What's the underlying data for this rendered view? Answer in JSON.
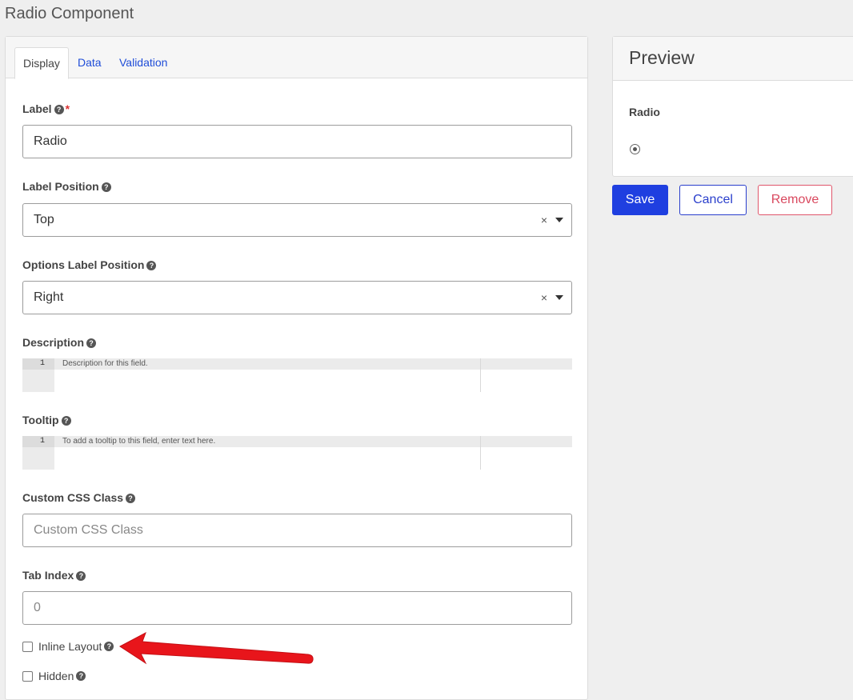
{
  "page": {
    "title": "Radio Component"
  },
  "tabs": [
    {
      "label": "Display",
      "active": true
    },
    {
      "label": "Data",
      "active": false
    },
    {
      "label": "Validation",
      "active": false
    }
  ],
  "fields": {
    "label": {
      "label": "Label",
      "required_mark": "*",
      "value": "Radio"
    },
    "label_position": {
      "label": "Label Position",
      "value": "Top",
      "clear": "×"
    },
    "options_label_position": {
      "label": "Options Label Position",
      "value": "Right",
      "clear": "×"
    },
    "description": {
      "label": "Description",
      "line_number": "1",
      "placeholder": "Description for this field."
    },
    "tooltip": {
      "label": "Tooltip",
      "line_number": "1",
      "placeholder": "To add a tooltip to this field, enter text here."
    },
    "custom_css_class": {
      "label": "Custom CSS Class",
      "placeholder": "Custom CSS Class"
    },
    "tab_index": {
      "label": "Tab Index",
      "placeholder": "0"
    },
    "inline_layout": {
      "label": "Inline Layout",
      "checked": false
    },
    "hidden": {
      "label": "Hidden",
      "checked": false
    }
  },
  "help_glyph": "?",
  "preview": {
    "title": "Preview",
    "field_label": "Radio"
  },
  "actions": {
    "save": "Save",
    "cancel": "Cancel",
    "remove": "Remove"
  },
  "colors": {
    "primary": "#1f3fe0",
    "danger": "#d9485e",
    "annotation_arrow": "#e8151b"
  }
}
